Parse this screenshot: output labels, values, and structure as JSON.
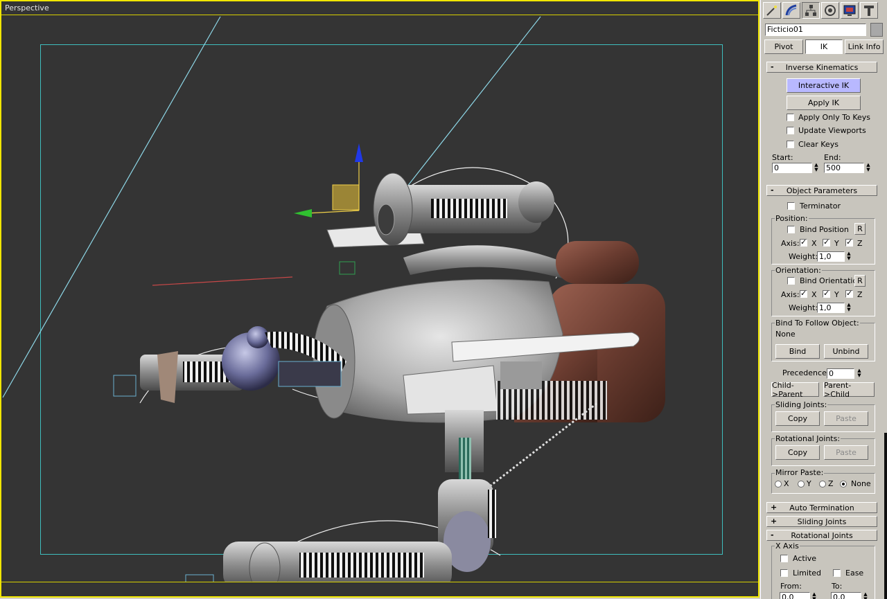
{
  "viewport": {
    "label": "Perspective"
  },
  "panel": {
    "tabs": [
      "create-icon",
      "modify-icon",
      "hierarchy-icon",
      "motion-icon",
      "display-icon",
      "utilities-icon"
    ],
    "object_name": "Ficticio01",
    "hier_tabs": {
      "pivot": "Pivot",
      "ik": "IK",
      "link_info": "Link Info"
    },
    "inverse_kinematics": {
      "title": "Inverse Kinematics",
      "interactive_ik": "Interactive IK",
      "apply_ik": "Apply IK",
      "apply_only_to_keys": "Apply Only To Keys",
      "update_viewports": "Update Viewports",
      "clear_keys": "Clear Keys",
      "start_label": "Start:",
      "end_label": "End:",
      "start_value": "0",
      "end_value": "500"
    },
    "object_parameters": {
      "title": "Object Parameters",
      "terminator": "Terminator",
      "position_group": "Position:",
      "bind_position": "Bind Position",
      "r": "R",
      "axis_label": "Axis:",
      "x": "X",
      "y": "Y",
      "z": "Z",
      "weight_label": "Weight:",
      "position_weight": "1,0",
      "orientation_group": "Orientation:",
      "bind_orientation": "Bind Orientation",
      "orientation_weight": "1,0",
      "bind_follow_group": "Bind To Follow Object:",
      "follow_object": "None",
      "bind": "Bind",
      "unbind": "Unbind",
      "precedence_label": "Precedence:",
      "precedence_value": "0",
      "child_parent": "Child->Parent",
      "parent_child": "Parent->Child",
      "sliding_joints_group": "Sliding Joints:",
      "rotational_joints_group": "Rotational Joints:",
      "copy": "Copy",
      "paste": "Paste",
      "mirror_paste_group": "Mirror Paste:",
      "mirror_options": [
        "X",
        "Y",
        "Z",
        "None"
      ],
      "mirror_selected": "None"
    },
    "collapsed_rollouts": [
      {
        "sign": "+",
        "title": "Auto Termination"
      },
      {
        "sign": "+",
        "title": "Sliding Joints"
      }
    ],
    "rotational_joints": {
      "sign": "-",
      "title": "Rotational Joints",
      "x_axis_group": "X Axis",
      "active": "Active",
      "limited": "Limited",
      "ease": "Ease",
      "from_label": "From:",
      "to_label": "To:",
      "from_value": "0,0",
      "to_value": "0,0"
    },
    "expanded_sign": "-"
  },
  "colors": {
    "viewport_bg": "#343434",
    "active_border": "#f0e600",
    "safe_frame": "#3fbfbf",
    "interactive_ik_bg": "#b8b8ff",
    "panel_bg": "#c8c5bd"
  }
}
